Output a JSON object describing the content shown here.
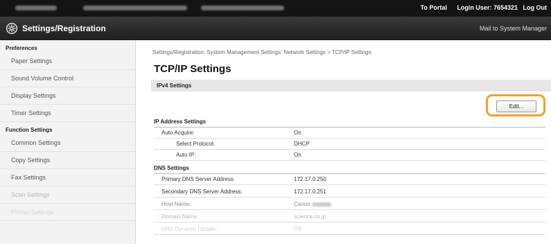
{
  "topbar": {
    "to_portal": "To Portal",
    "login_user": "Login User: 7654321",
    "log_out": "Log Out"
  },
  "header": {
    "title": "Settings/Registration",
    "mail_to": "Mail to System Manager"
  },
  "sidebar": {
    "sections": [
      {
        "label": "Preferences"
      },
      {
        "label": "Function Settings"
      }
    ],
    "items": [
      {
        "label": "Paper Settings"
      },
      {
        "label": "Sound Volume Control"
      },
      {
        "label": "Display Settings"
      },
      {
        "label": "Timer Settings"
      },
      {
        "label": "Common Settings"
      },
      {
        "label": "Copy Settings"
      },
      {
        "label": "Fax Settings"
      },
      {
        "label": "Scan Settings"
      },
      {
        "label": "Printer Settings"
      }
    ]
  },
  "main": {
    "breadcrumb": "Settings/Registration: System Management Settings: Network Settings > TCP/IP Settings",
    "title": "TCP/IP Settings",
    "section": "IPv4 Settings",
    "edit_label": "Edit...",
    "ip_group": {
      "title": "IP Address Settings",
      "rows": [
        {
          "key": "Auto Acquire:",
          "value": "On"
        },
        {
          "key": "Select Protocol:",
          "value": "DHCP"
        },
        {
          "key": "Auto IP:",
          "value": "On"
        }
      ]
    },
    "dns_group": {
      "title": "DNS Settings",
      "rows": [
        {
          "key": "Primary DNS Server Address:",
          "value": "172.17.0.250"
        },
        {
          "key": "Secondary DNS Server Address:",
          "value": "172.17.0.251"
        },
        {
          "key": "Host Name:",
          "value": "Canon"
        },
        {
          "key": "Domain Name:",
          "value": "science.co.jp"
        },
        {
          "key": "DNS Dynamic Update:",
          "value": "Off"
        }
      ]
    }
  },
  "colors": {
    "highlight": "#f0a12a",
    "topbar": "#141414",
    "titlebar": "#2a2a2a"
  }
}
